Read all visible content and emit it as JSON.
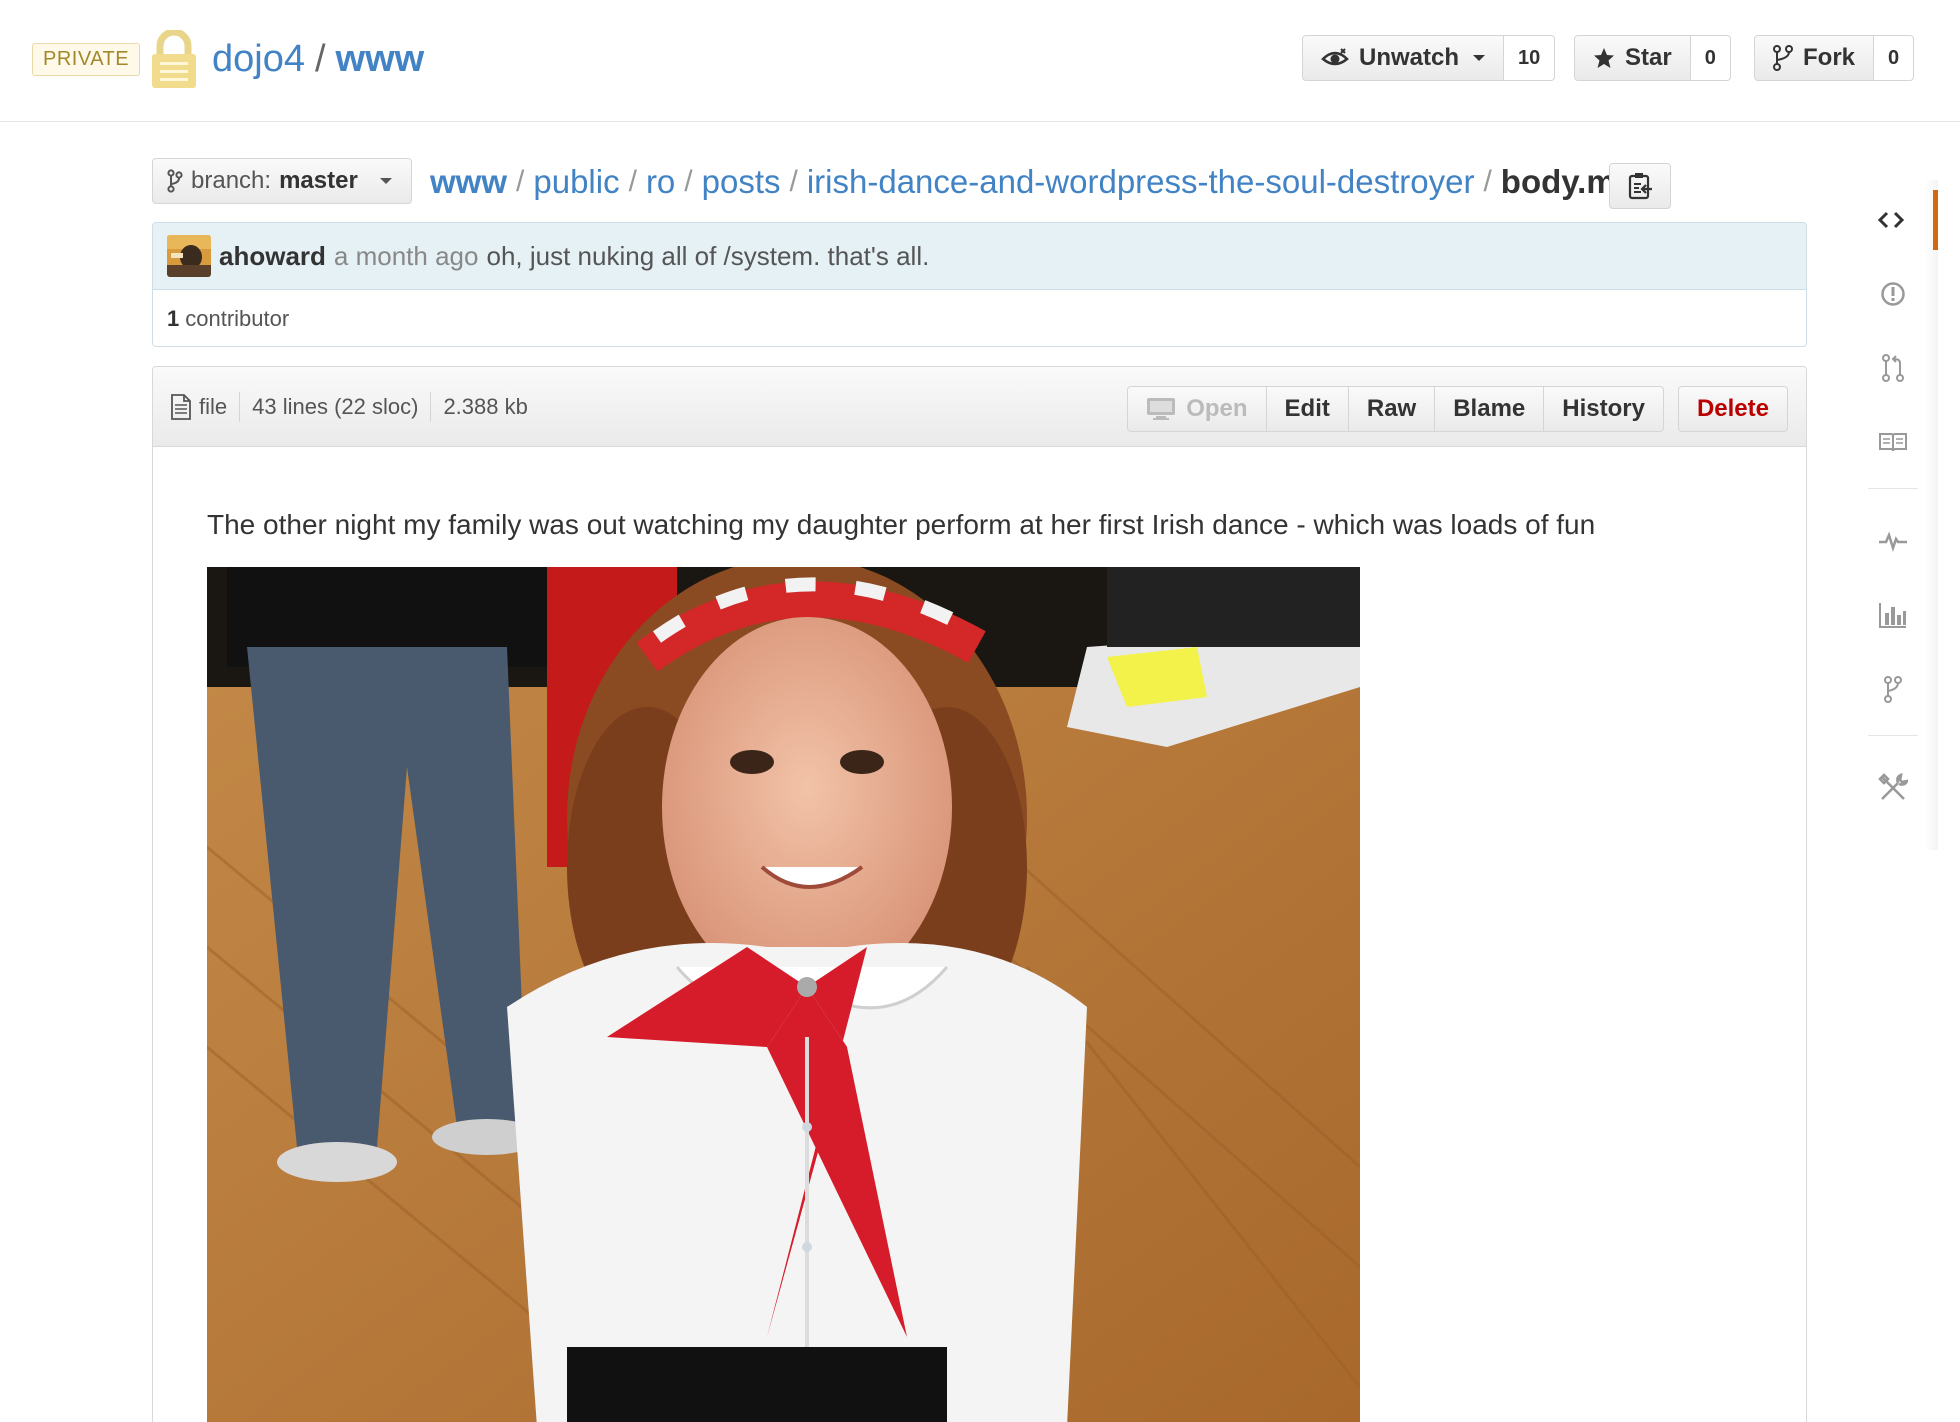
{
  "repo": {
    "private_label": "PRIVATE",
    "owner": "dojo4",
    "separator": "/",
    "name": "www"
  },
  "header_actions": {
    "watch": {
      "label": "Unwatch",
      "count": "10",
      "icon": "eye-icon"
    },
    "star": {
      "label": "Star",
      "count": "0",
      "icon": "star-icon"
    },
    "fork": {
      "label": "Fork",
      "count": "0",
      "icon": "fork-icon"
    }
  },
  "branch": {
    "prefix": "branch:",
    "name": "master",
    "icon": "branch-icon"
  },
  "breadcrumb": {
    "segments": [
      "www",
      "public",
      "ro",
      "posts",
      "irish-dance-and-wordpress-the-soul-destroyer"
    ],
    "separator": "/",
    "final": "body.md"
  },
  "commit": {
    "author": "ahoward",
    "time": "a month ago",
    "message": "oh, just nuking all of /system. that's all.",
    "contributors_count": "1",
    "contributors_label": "contributor"
  },
  "file": {
    "type_label": "file",
    "lines": "43 lines (22 sloc)",
    "size": "2.388 kb",
    "actions": {
      "open": "Open",
      "edit": "Edit",
      "raw": "Raw",
      "blame": "Blame",
      "history": "History",
      "delete": "Delete"
    }
  },
  "content": {
    "paragraph": "The other night my family was out watching my daughter perform at her first Irish dance - which was loads of fun"
  },
  "side_nav": [
    "code-icon",
    "issues-icon",
    "pull-request-icon",
    "wiki-icon",
    "pulse-icon",
    "graphs-icon",
    "network-icon",
    "settings-icon"
  ],
  "colors": {
    "link": "#4183c4",
    "danger": "#bb0000",
    "accent_selected": "#d26911",
    "private_badge_bg": "#fff9ea"
  }
}
